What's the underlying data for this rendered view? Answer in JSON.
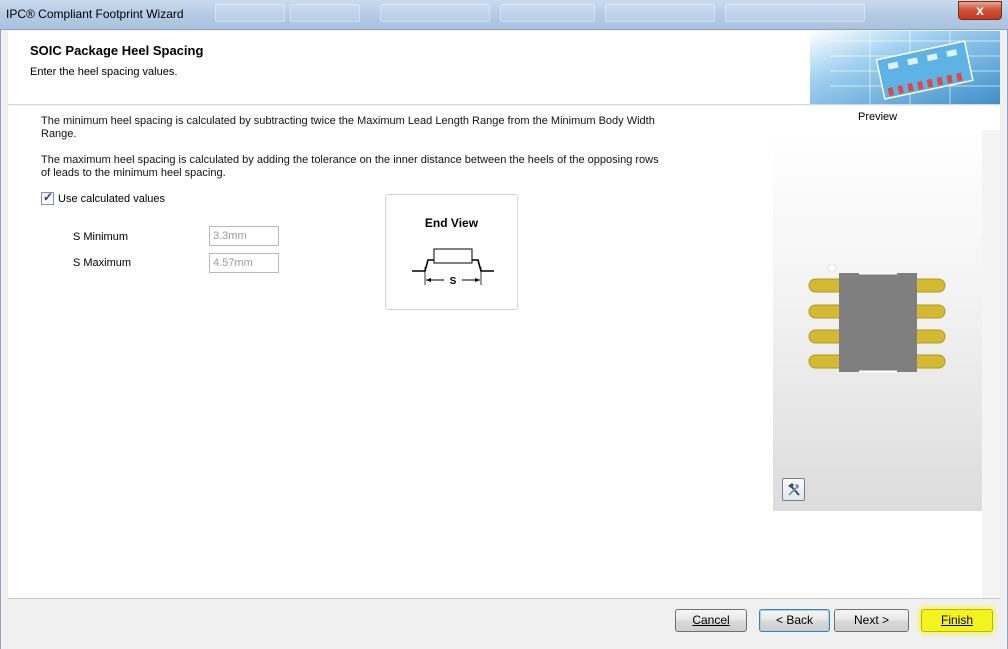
{
  "window": {
    "title": "IPC® Compliant Footprint Wizard",
    "close_glyph": "x"
  },
  "header": {
    "title": "SOIC Package Heel Spacing",
    "subtitle": "Enter the heel spacing values."
  },
  "main": {
    "description_1": "The minimum heel spacing is calculated by subtracting twice the Maximum Lead Length Range from the Minimum Body Width Range.",
    "description_2": "The maximum heel spacing is calculated by adding the tolerance on the inner distance between the heels of the opposing rows of leads to the minimum heel spacing.",
    "use_calculated": {
      "label": "Use calculated values",
      "checked": true
    },
    "s_minimum": {
      "label": "S Minimum",
      "value": "3.3mm"
    },
    "s_maximum": {
      "label": "S Maximum",
      "value": "4.57mm"
    },
    "end_view": {
      "title": "End View",
      "dimension_label": "S"
    }
  },
  "preview": {
    "label": "Preview",
    "tool_icon": "hammer-wrench-icon",
    "body_color": "#7f7f7f",
    "pad_color": "#d4b932"
  },
  "footer": {
    "cancel": "Cancel",
    "back": "< Back",
    "next": "Next >",
    "finish": "Finish",
    "finish_highlight": "#f3f31f"
  }
}
